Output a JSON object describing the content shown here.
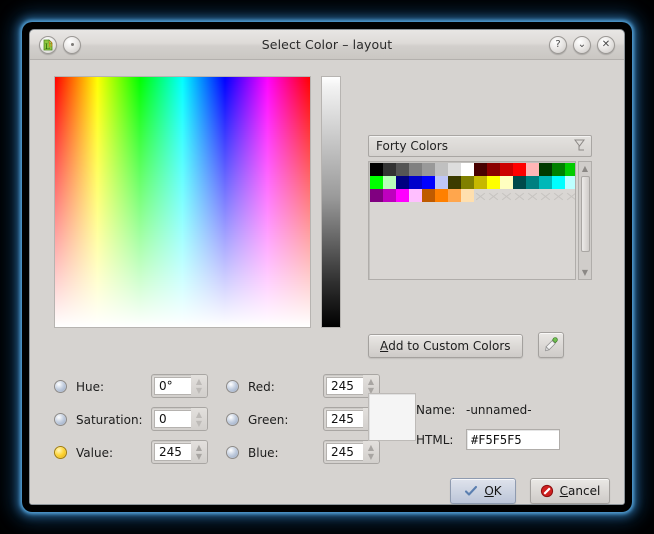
{
  "window": {
    "title": "Select Color – layout",
    "app_icon": "libreoffice-icon",
    "pin_icon": "stay-on-top-icon",
    "help_icon": "?",
    "shade_icon": "⌄",
    "close_icon": "✕"
  },
  "gradient": {
    "map_name": "hue-saturation-map",
    "slider_name": "value-slider"
  },
  "palette": {
    "selected": "Forty Colors",
    "dropdown_icon": "combo-arrow-icon",
    "colors": [
      "#000000",
      "#333333",
      "#555555",
      "#808080",
      "#999999",
      "#C0C0C0",
      "#DDDDDD",
      "#FFFFFF",
      "#480000",
      "#8B0000",
      "#CC0000",
      "#FF0000",
      "#FFB6B6",
      "#003A00",
      "#008000",
      "#00CC00",
      "#00FF00",
      "#B9FFB9",
      "#000080",
      "#0000CC",
      "#0000FF",
      "#BFC6F7",
      "#3B3B00",
      "#808000",
      "#C6B800",
      "#FFFF00",
      "#FFFFC0",
      "#004A4A",
      "#008080",
      "#00B8B8",
      "#00FFFF",
      "#BDFFFF",
      "#800080",
      "#BE00BE",
      "#FF00FF",
      "#FFBFFF",
      "#BF5B00",
      "#FF8000",
      "#FFA64D",
      "#FFDFAE"
    ],
    "empty_cells": 8,
    "scrollbar": {
      "up_icon": "▲",
      "down_icon": "▼"
    }
  },
  "actions": {
    "add_to_custom_label_prefix": "A",
    "add_to_custom_label_rest": "dd to Custom Colors",
    "picker_icon": "eyedropper-icon"
  },
  "channels": {
    "left": [
      {
        "name": "hue",
        "label": "Hue:",
        "value": "0°",
        "selected": true
      },
      {
        "name": "saturation",
        "label": "Saturation:",
        "value": "0",
        "selected": false
      },
      {
        "name": "value",
        "label": "Value:",
        "value": "245",
        "selected": false
      }
    ],
    "right": [
      {
        "name": "red",
        "label": "Red:",
        "value": "245",
        "selected": false
      },
      {
        "name": "green",
        "label": "Green:",
        "value": "245",
        "selected": false
      },
      {
        "name": "blue",
        "label": "Blue:",
        "value": "245",
        "selected": false
      }
    ],
    "selected_radio": "value",
    "spin_up_icon": "▲",
    "spin_down_icon": "▼"
  },
  "result": {
    "preview_color": "#F5F5F5",
    "name_label": "Name:",
    "name_value": "-unnamed-",
    "html_label": "HTML:",
    "html_value": "#F5F5F5"
  },
  "footer": {
    "ok_prefix": "O",
    "ok_rest": "K",
    "ok_icon": "check-icon",
    "cancel_prefix": "C",
    "cancel_rest": "ancel",
    "cancel_icon": "forbidden-icon"
  }
}
